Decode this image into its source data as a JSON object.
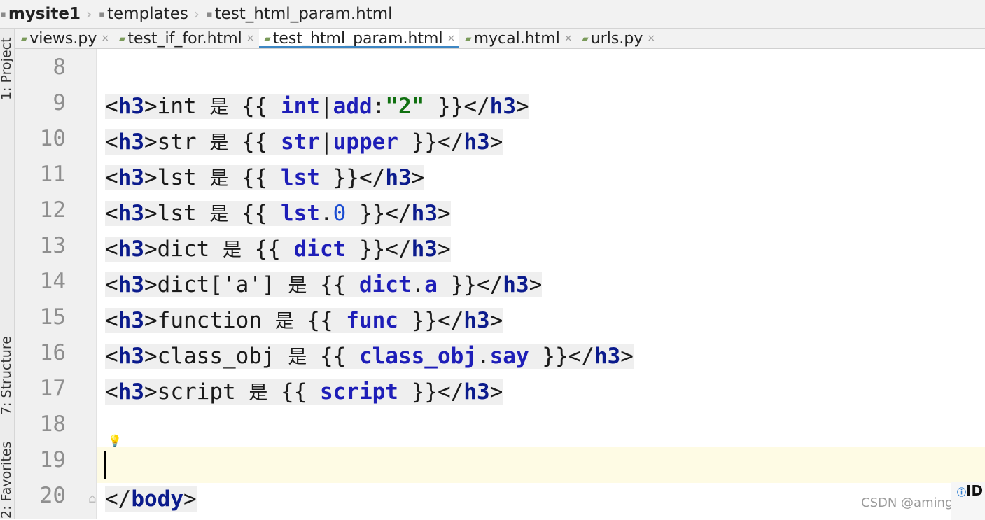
{
  "breadcrumb": {
    "items": [
      "mysite1",
      "templates",
      "test_html_param.html"
    ]
  },
  "tabs": [
    {
      "label": "views.py",
      "active": false
    },
    {
      "label": "test_if_for.html",
      "active": false
    },
    {
      "label": "test_html_param.html",
      "active": true
    },
    {
      "label": "mycal.html",
      "active": false
    },
    {
      "label": "urls.py",
      "active": false
    }
  ],
  "tool_windows": {
    "project": "1: Project",
    "structure": "7: Structure",
    "favorites": "2: Favorites"
  },
  "gutter": {
    "line_numbers": [
      "8",
      "9",
      "10",
      "11",
      "12",
      "13",
      "14",
      "15",
      "16",
      "17",
      "18",
      "19",
      "20"
    ]
  },
  "code_lines": [
    [],
    [
      {
        "t": "<",
        "c": "p"
      },
      {
        "t": "h3",
        "c": "kw"
      },
      {
        "t": ">int ",
        "c": "p"
      },
      {
        "t": "是",
        "c": "cjk"
      },
      {
        "t": " {{ ",
        "c": "p"
      },
      {
        "t": "int",
        "c": "var"
      },
      {
        "t": "|",
        "c": "p"
      },
      {
        "t": "add",
        "c": "var"
      },
      {
        "t": ":",
        "c": "p"
      },
      {
        "t": "\"2\"",
        "c": "str"
      },
      {
        "t": " }}</",
        "c": "p"
      },
      {
        "t": "h3",
        "c": "kw"
      },
      {
        "t": ">",
        "c": "p"
      }
    ],
    [
      {
        "t": "<",
        "c": "p"
      },
      {
        "t": "h3",
        "c": "kw"
      },
      {
        "t": ">str ",
        "c": "p"
      },
      {
        "t": "是",
        "c": "cjk"
      },
      {
        "t": " {{ ",
        "c": "p"
      },
      {
        "t": "str",
        "c": "var"
      },
      {
        "t": "|",
        "c": "p"
      },
      {
        "t": "upper",
        "c": "var"
      },
      {
        "t": " }}</",
        "c": "p"
      },
      {
        "t": "h3",
        "c": "kw"
      },
      {
        "t": ">",
        "c": "p"
      }
    ],
    [
      {
        "t": "<",
        "c": "p"
      },
      {
        "t": "h3",
        "c": "kw"
      },
      {
        "t": ">lst ",
        "c": "p"
      },
      {
        "t": "是",
        "c": "cjk"
      },
      {
        "t": " {{ ",
        "c": "p"
      },
      {
        "t": "lst",
        "c": "var"
      },
      {
        "t": " }}</",
        "c": "p"
      },
      {
        "t": "h3",
        "c": "kw"
      },
      {
        "t": ">",
        "c": "p"
      }
    ],
    [
      {
        "t": "<",
        "c": "p"
      },
      {
        "t": "h3",
        "c": "kw"
      },
      {
        "t": ">lst ",
        "c": "p"
      },
      {
        "t": "是",
        "c": "cjk"
      },
      {
        "t": " {{ ",
        "c": "p"
      },
      {
        "t": "lst",
        "c": "var"
      },
      {
        "t": ".",
        "c": "p"
      },
      {
        "t": "0",
        "c": "num"
      },
      {
        "t": " }}</",
        "c": "p"
      },
      {
        "t": "h3",
        "c": "kw"
      },
      {
        "t": ">",
        "c": "p"
      }
    ],
    [
      {
        "t": "<",
        "c": "p"
      },
      {
        "t": "h3",
        "c": "kw"
      },
      {
        "t": ">dict ",
        "c": "p"
      },
      {
        "t": "是",
        "c": "cjk"
      },
      {
        "t": " {{ ",
        "c": "p"
      },
      {
        "t": "dict",
        "c": "var"
      },
      {
        "t": " }}</",
        "c": "p"
      },
      {
        "t": "h3",
        "c": "kw"
      },
      {
        "t": ">",
        "c": "p"
      }
    ],
    [
      {
        "t": "<",
        "c": "p"
      },
      {
        "t": "h3",
        "c": "kw"
      },
      {
        "t": ">dict['a'] ",
        "c": "p"
      },
      {
        "t": "是",
        "c": "cjk"
      },
      {
        "t": " {{ ",
        "c": "p"
      },
      {
        "t": "dict",
        "c": "var"
      },
      {
        "t": ".",
        "c": "p"
      },
      {
        "t": "a",
        "c": "var"
      },
      {
        "t": " }}</",
        "c": "p"
      },
      {
        "t": "h3",
        "c": "kw"
      },
      {
        "t": ">",
        "c": "p"
      }
    ],
    [
      {
        "t": "<",
        "c": "p"
      },
      {
        "t": "h3",
        "c": "kw"
      },
      {
        "t": ">function ",
        "c": "p"
      },
      {
        "t": "是",
        "c": "cjk"
      },
      {
        "t": " {{ ",
        "c": "p"
      },
      {
        "t": "func",
        "c": "var"
      },
      {
        "t": " }}</",
        "c": "p"
      },
      {
        "t": "h3",
        "c": "kw"
      },
      {
        "t": ">",
        "c": "p"
      }
    ],
    [
      {
        "t": "<",
        "c": "p"
      },
      {
        "t": "h3",
        "c": "kw"
      },
      {
        "t": ">class_obj ",
        "c": "p"
      },
      {
        "t": "是",
        "c": "cjk"
      },
      {
        "t": " {{ ",
        "c": "p"
      },
      {
        "t": "class_obj",
        "c": "var"
      },
      {
        "t": ".",
        "c": "p"
      },
      {
        "t": "say",
        "c": "var"
      },
      {
        "t": " }}</",
        "c": "p"
      },
      {
        "t": "h3",
        "c": "kw"
      },
      {
        "t": ">",
        "c": "p"
      }
    ],
    [
      {
        "t": "<",
        "c": "p"
      },
      {
        "t": "h3",
        "c": "kw"
      },
      {
        "t": ">script ",
        "c": "p"
      },
      {
        "t": "是",
        "c": "cjk"
      },
      {
        "t": " {{ ",
        "c": "p"
      },
      {
        "t": "script",
        "c": "var"
      },
      {
        "t": " }}</",
        "c": "p"
      },
      {
        "t": "h3",
        "c": "kw"
      },
      {
        "t": ">",
        "c": "p"
      }
    ],
    [],
    [],
    [
      {
        "t": "</",
        "c": "p"
      },
      {
        "t": "body",
        "c": "kw"
      },
      {
        "t": ">",
        "c": "p"
      }
    ]
  ],
  "caret_line": "19",
  "watermark": "CSDN @amingMM",
  "notification": {
    "text": "ID"
  }
}
